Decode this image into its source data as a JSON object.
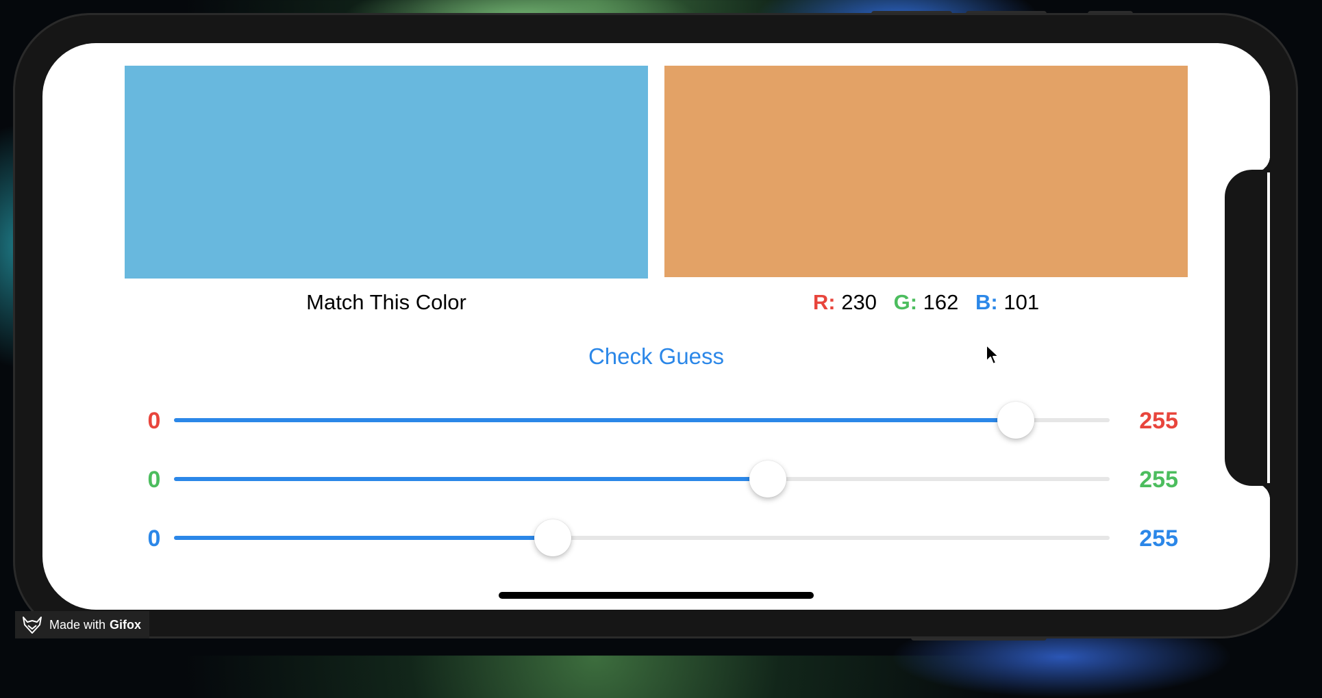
{
  "target": {
    "caption": "Match This Color",
    "color": "#68b8de"
  },
  "guess": {
    "color": "#e3a266",
    "r_label": "R:",
    "r_value": "230",
    "g_label": "G:",
    "g_value": "162",
    "b_label": "B:",
    "b_value": "101"
  },
  "check_button": {
    "label": "Check Guess"
  },
  "sliders": [
    {
      "name": "red",
      "min": "0",
      "max": "255",
      "value_fraction": 0.9,
      "color": "#e8453c"
    },
    {
      "name": "green",
      "min": "0",
      "max": "255",
      "value_fraction": 0.635,
      "color": "#4cbd5e"
    },
    {
      "name": "blue",
      "min": "0",
      "max": "255",
      "value_fraction": 0.405,
      "color": "#2b87e8"
    }
  ],
  "accent_color": "#2b87e8",
  "watermark": {
    "prefix": "Made with",
    "brand": "Gifox",
    "icon": "fox-icon"
  }
}
